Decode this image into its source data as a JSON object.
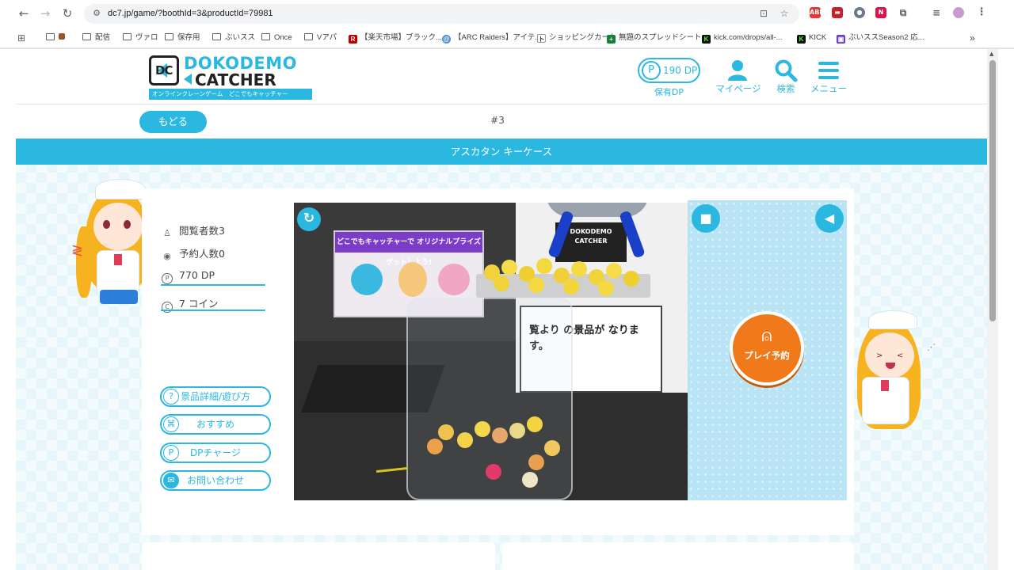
{
  "browser": {
    "url": "dc7.jp/game/?boothId=3&productId=79981",
    "bookmarks": [
      {
        "label": "",
        "kind": "folder"
      },
      {
        "label": "配信",
        "kind": "folder"
      },
      {
        "label": "ヴァロ",
        "kind": "folder"
      },
      {
        "label": "保存用",
        "kind": "folder"
      },
      {
        "label": "ぶいスス",
        "kind": "folder"
      },
      {
        "label": "Once",
        "kind": "folder"
      },
      {
        "label": "Vアパ",
        "kind": "folder"
      },
      {
        "label": "【楽天市場】ブラック...",
        "kind": "site"
      },
      {
        "label": "【ARC Raiders】アイテ...",
        "kind": "site"
      },
      {
        "label": "ショッピングカート",
        "kind": "site"
      },
      {
        "label": "無題のスプレッドシート...",
        "kind": "site"
      },
      {
        "label": "kick.com/drops/all-...",
        "kind": "site"
      },
      {
        "label": "KICK",
        "kind": "site"
      },
      {
        "label": "ぶいススSeason2 応...",
        "kind": "site"
      }
    ],
    "more_bookmarks": "»"
  },
  "header": {
    "logo_line1": "DOKODEMO",
    "logo_line2": "CATCHER",
    "logo_tagline": "オンラインクレーンゲーム　どこでもキャッチャー",
    "dp_value": "190 DP",
    "dp_label": "保有DP",
    "mypage_label": "マイページ",
    "search_label": "検索",
    "menu_label": "メニュー"
  },
  "subbar": {
    "back_label": "もどる",
    "booth_number": "#3"
  },
  "product": {
    "title": "アスカタン キーケース"
  },
  "stats": {
    "viewers": "閲覧者数3",
    "reservations": "予約人数0",
    "price_dp": "770 DP",
    "price_coin": "7 コイン"
  },
  "side_buttons": {
    "details": "景品詳細/遊び方",
    "recommend": "おすすめ",
    "dp_charge": "DPチャージ",
    "contact": "お問い合わせ"
  },
  "control": {
    "reserve_label": "プレイ予約"
  },
  "video_scene": {
    "board_header": "どこでもキャッチャーで オリジナルプライズゲットしよう!",
    "box_logo": "DOKODEMO CATCHER",
    "sign_text": "覧より の景品が なります。"
  },
  "colors": {
    "brand": "#2bb8e0",
    "reserve_button": "#f07a1a"
  }
}
